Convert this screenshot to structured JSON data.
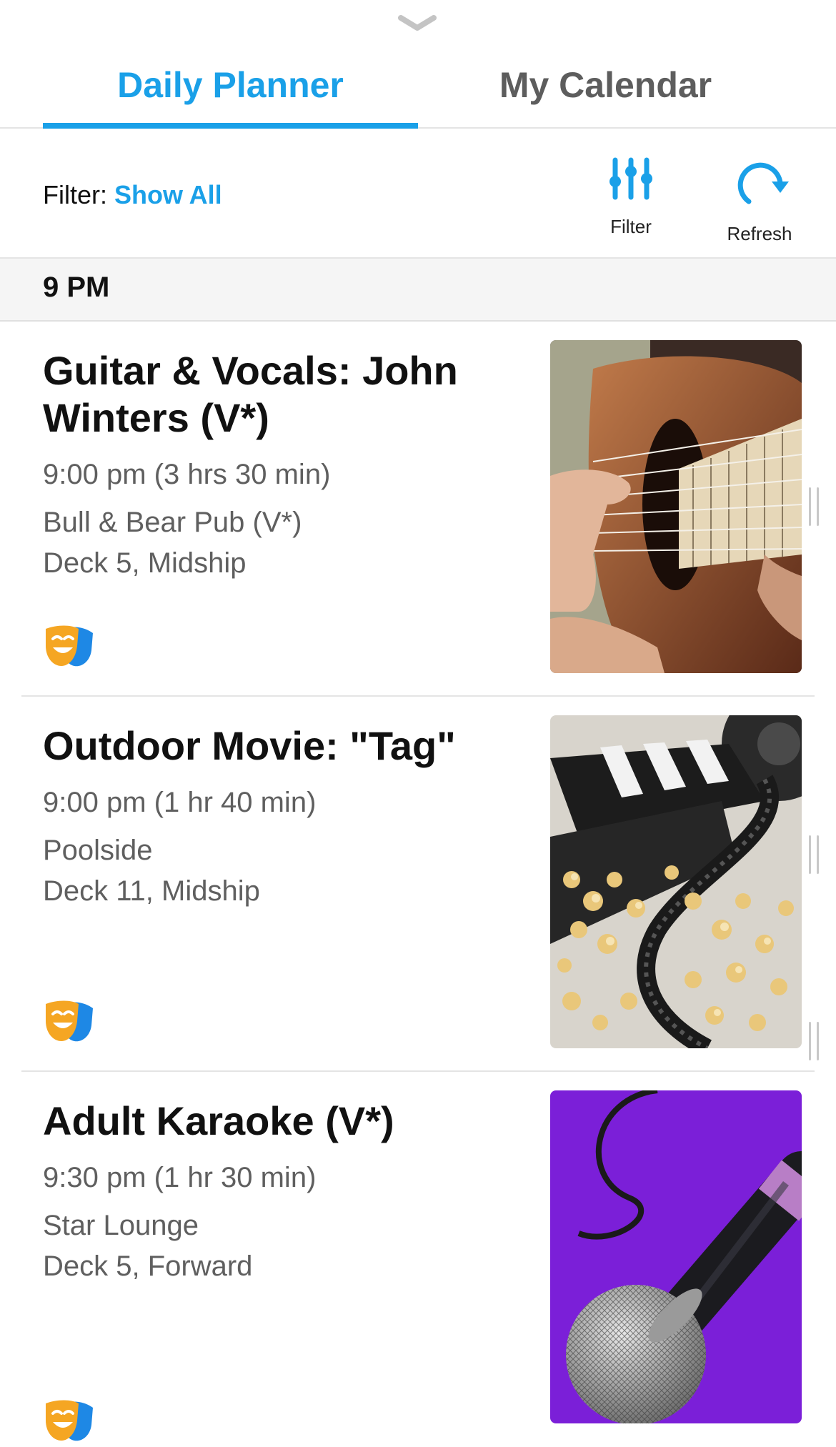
{
  "tabs": [
    {
      "label": "Daily Planner",
      "active": true
    },
    {
      "label": "My Calendar",
      "active": false
    }
  ],
  "filter": {
    "prefix": "Filter:",
    "value": "Show All",
    "filter_button_label": "Filter",
    "refresh_button_label": "Refresh"
  },
  "section": {
    "time_header": "9 PM"
  },
  "events": [
    {
      "title": "Guitar & Vocals: John Winters (V*)",
      "time": "9:00 pm (3 hrs 30 min)",
      "venue": "Bull & Bear Pub (V*)",
      "location": "Deck 5, Midship",
      "category_icon": "theater-masks-icon",
      "image": "guitar-photo"
    },
    {
      "title": "Outdoor Movie: \"Tag\"",
      "time": "9:00 pm (1 hr 40 min)",
      "venue": "Poolside",
      "location": "Deck 11, Midship",
      "category_icon": "theater-masks-icon",
      "image": "movie-popcorn-photo"
    },
    {
      "title": "Adult Karaoke (V*)",
      "time": "9:30 pm (1 hr 30 min)",
      "venue": "Star Lounge",
      "location": "Deck 5, Forward",
      "category_icon": "theater-masks-icon",
      "image": "microphone-photo"
    }
  ],
  "colors": {
    "accent": "#1aa0e8",
    "mask_orange": "#f5a623",
    "mask_blue": "#1e88e5",
    "karaoke_background": "#7b1fd8"
  }
}
